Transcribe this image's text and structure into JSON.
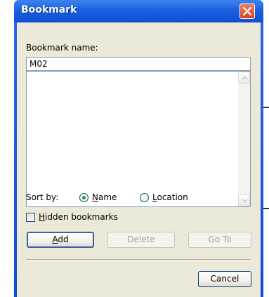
{
  "window": {
    "title": "Bookmark",
    "close_icon": "close-icon"
  },
  "form": {
    "name_label": "Bookmark name:",
    "name_value": "M02",
    "bookmarks": [],
    "sort_by_label": "Sort by:",
    "sort_options": [
      {
        "label": "Name",
        "selected": true
      },
      {
        "label": "Location",
        "selected": false
      }
    ],
    "hidden_bookmarks_label": "Hidden bookmarks",
    "hidden_bookmarks_checked": false
  },
  "buttons": {
    "add": "Add",
    "delete": "Delete",
    "goto": "Go To",
    "cancel": "Cancel"
  },
  "colors": {
    "title_bar": "#0f4fd4",
    "close_button": "#d8431f",
    "dialog_face": "#ece9d8",
    "radio_dot": "#21a121"
  }
}
